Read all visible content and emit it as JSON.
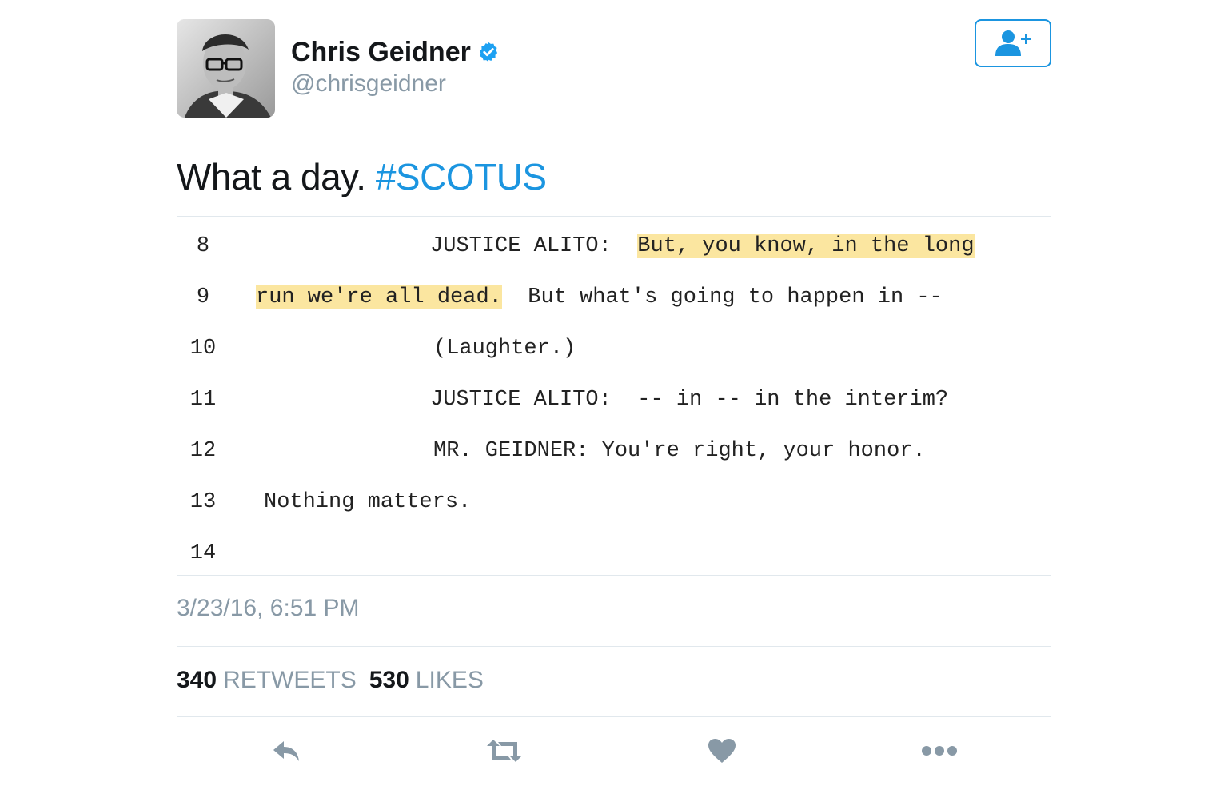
{
  "user": {
    "display_name": "Chris Geidner",
    "handle": "@chrisgeidner",
    "verified": true,
    "avatar_icon": "user-photo-avatar"
  },
  "follow_button": {
    "icon": "follow-user-icon",
    "color": "#1b95e0"
  },
  "tweet": {
    "text": "What a day.",
    "hashtag": "#SCOTUS",
    "timestamp": "3/23/16, 6:51 PM"
  },
  "transcript": {
    "lines": [
      {
        "num": "8",
        "parts": [
          {
            "text": "JUSTICE ALITO:  ",
            "highlight": false
          },
          {
            "text": "But, you know, in the long",
            "highlight": true
          }
        ]
      },
      {
        "num": "9",
        "parts": [
          {
            "text": "run we're all dead.",
            "highlight": true
          },
          {
            "text": "  But what's going to happen in --",
            "highlight": false
          }
        ]
      },
      {
        "num": "10",
        "parts": [
          {
            "text": "(Laughter.)",
            "highlight": false
          }
        ]
      },
      {
        "num": "11",
        "parts": [
          {
            "text": "JUSTICE ALITO:  -- in -- in the interim?",
            "highlight": false
          }
        ]
      },
      {
        "num": "12",
        "parts": [
          {
            "text": "MR. GEIDNER: You're right, your honor.",
            "highlight": false
          }
        ]
      },
      {
        "num": "13",
        "parts": [
          {
            "text": "Nothing matters.",
            "highlight": false
          }
        ]
      },
      {
        "num": "14",
        "parts": []
      }
    ]
  },
  "stats": {
    "retweets_count": "340",
    "retweets_label": "RETWEETS",
    "likes_count": "530",
    "likes_label": "LIKES"
  },
  "actions": {
    "reply_icon": "reply-icon",
    "retweet_icon": "retweet-icon",
    "like_icon": "heart-icon",
    "more_icon": "more-dots-icon",
    "icon_color": "#8899a6"
  },
  "colors": {
    "accent": "#1b95e0",
    "secondary_text": "#8899a6",
    "highlight": "#fbe6a0",
    "divider": "#e1e8ed"
  }
}
